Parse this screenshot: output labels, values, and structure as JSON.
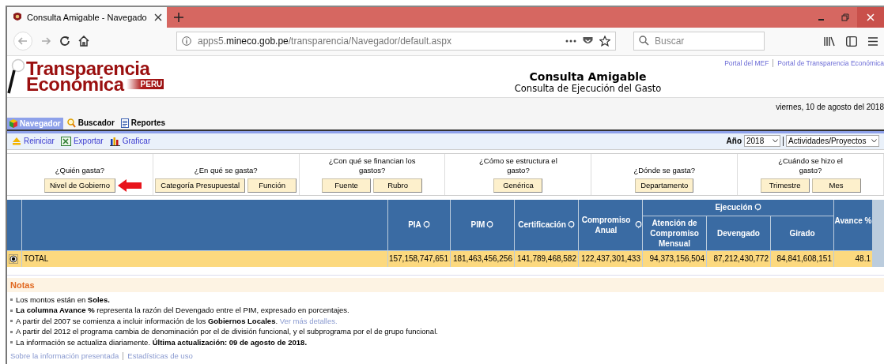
{
  "browser": {
    "tab_title": "Consulta Amigable - Navegado",
    "url": {
      "host_prefix": "apps5.",
      "host": "mineco.gob.pe",
      "path": "/transparencia/Navegador/default.aspx"
    },
    "search": {
      "placeholder": "Buscar"
    }
  },
  "header": {
    "top_links": [
      "Portal del MEF",
      "Portal de Transparencia Económica"
    ],
    "logo": {
      "line1": "Transparencia",
      "line2": "Económica",
      "badge": "PERU"
    },
    "title": "Consulta Amigable",
    "subtitle": "Consulta de Ejecución del Gasto",
    "date": "viernes, 10 de agosto del 2018"
  },
  "nav_tabs": [
    {
      "label": "Navegador",
      "kind": "cube",
      "selected": true
    },
    {
      "label": "Buscador",
      "kind": "search",
      "selected": false
    },
    {
      "label": "Reportes",
      "kind": "document",
      "selected": false
    }
  ],
  "actions": [
    {
      "label": "Reiniciar",
      "kind": "reset"
    },
    {
      "label": "Exportar",
      "kind": "excel"
    },
    {
      "label": "Graficar",
      "kind": "chart"
    }
  ],
  "year": {
    "label": "Año",
    "value": "2018"
  },
  "view": {
    "value": "Actividades/Proyectos"
  },
  "filters": [
    {
      "question": "¿Quién gasta?",
      "buttons": [
        "Nivel de Gobierno"
      ],
      "pointer": true
    },
    {
      "question": "¿En qué se gasta?",
      "buttons": [
        "Categoría Presupuestal",
        "Función"
      ],
      "pointer": false
    },
    {
      "question": "¿Con qué se financian los gastos?",
      "buttons": [
        "Fuente",
        "Rubro"
      ],
      "pointer": false
    },
    {
      "question": "¿Cómo se estructura el gasto?",
      "buttons": [
        "Genérica"
      ],
      "pointer": false
    },
    {
      "question": "¿Dónde se gasta?",
      "buttons": [
        "Departamento"
      ],
      "pointer": false
    },
    {
      "question": "¿Cuándo se hizo el gasto?",
      "buttons": [
        "Trimestre",
        "Mes"
      ],
      "pointer": false
    }
  ],
  "table": {
    "columns": [
      {
        "label": "PIA",
        "info": true
      },
      {
        "label": "PIM",
        "info": true
      },
      {
        "label": "Certificación",
        "info": true
      },
      {
        "label": "Compromiso Anual",
        "info": true
      }
    ],
    "group": {
      "label": "Ejecución",
      "info": true,
      "columns": [
        "Atención de Compromiso Mensual",
        "Devengado",
        "Girado"
      ]
    },
    "last_column": "Avance %",
    "rows": [
      {
        "label": "TOTAL",
        "selected": true,
        "values": [
          "157,158,747,651",
          "181,463,456,256",
          "141,789,468,582",
          "122,437,301,433",
          "94,373,156,504",
          "87,212,430,772",
          "84,841,608,151",
          "48.1"
        ]
      }
    ]
  },
  "notes": {
    "title": "Notas",
    "items": [
      {
        "text": "Los montos están en **Soles.**"
      },
      {
        "text": "**La columna Avance %** representa la razón del Devengado entre el PIM, expresado en porcentajes."
      },
      {
        "text": "A partir del 2007 se comienza a incluir información de los **Gobiernos Locales**.",
        "link": "Ver más detalles."
      },
      {
        "text": "A partir del 2012 el programa cambia de denominación por el de división funcional, y el subprograma por el de grupo funcional."
      },
      {
        "text": "La información se actualiza diariamente. **Última actualización: 09 de agosto de 2018.**"
      }
    ]
  },
  "footer_links": [
    "Sobre la información presentada",
    "Estadísticas de uso"
  ]
}
